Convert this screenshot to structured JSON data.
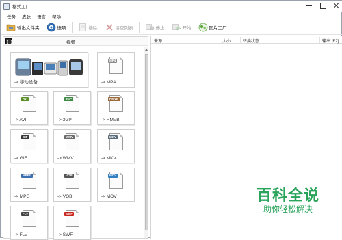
{
  "window": {
    "title": "格式工厂"
  },
  "menu": {
    "items": [
      "任务",
      "皮肤",
      "语言",
      "帮助"
    ]
  },
  "toolbar": {
    "output_folder": "输出文件夹",
    "options": "选项",
    "remove": "移除",
    "clear_list": "清空列表",
    "stop": "停止",
    "start": "开始",
    "home": "图片工厂"
  },
  "sidebar": {
    "category": "视频"
  },
  "tiles": [
    {
      "label": "-> 移动设备",
      "icon": "mobile-devices-icon"
    },
    {
      "label": "-> MP4",
      "tag": "MP4",
      "tag_color": "#8a8a8a",
      "icon": "mp4-file-icon"
    },
    {
      "label": "-> AVI",
      "tag": "AVI",
      "tag_color": "#5b8f29",
      "icon": "avi-file-icon"
    },
    {
      "label": "-> 3GP",
      "tag": "3GP",
      "tag_color": "#3e8a44",
      "icon": "3gp-file-icon"
    },
    {
      "label": "-> RMVB",
      "tag": "RMVB",
      "tag_color": "#9a6a3a",
      "icon": "rmvb-file-icon"
    },
    {
      "label": "-> GIF",
      "tag": "GIF",
      "tag_color": "#3a3a3a",
      "icon": "gif-file-icon"
    },
    {
      "label": "-> WMV",
      "tag": "WMV",
      "tag_color": "#6b6b6b",
      "icon": "wmv-file-icon"
    },
    {
      "label": "-> MKV",
      "tag": "MKV",
      "tag_color": "#5a6b7a",
      "icon": "mkv-file-icon"
    },
    {
      "label": "-> MPG",
      "tag": "MPEG",
      "tag_color": "#3d6fae",
      "icon": "mpg-file-icon"
    },
    {
      "label": "-> VOB",
      "tag": "VOB",
      "tag_color": "#555555",
      "icon": "vob-file-icon"
    },
    {
      "label": "-> MOV",
      "tag": "MOV",
      "tag_color": "#2f7fc1",
      "icon": "mov-file-icon"
    },
    {
      "label": "-> FLV",
      "tag": "FLV",
      "tag_color": "#444444",
      "icon": "flv-file-icon"
    },
    {
      "label": "-> SWF",
      "tag": "SWF",
      "tag_color": "#c8261c",
      "icon": "swf-file-icon"
    }
  ],
  "list": {
    "columns": [
      "来源",
      "大小",
      "转换状态",
      "输出 [F2]"
    ]
  },
  "watermark": {
    "main": "百科全说",
    "sub": "助你轻松解决"
  },
  "colors": {
    "watermark": "#2aa35b",
    "accent": "#1e6fc2"
  }
}
